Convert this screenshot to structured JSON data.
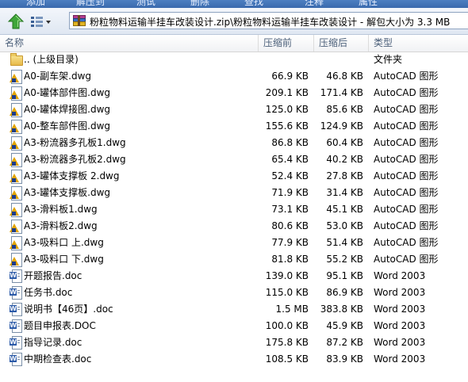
{
  "toolbar": {
    "buttons": [
      "添加",
      "解压到",
      "测试",
      "删除",
      "查找",
      "注释",
      "属性"
    ]
  },
  "address": {
    "path": "粉粒物料运输半挂车改装设计.zip\\粉粒物料运输半挂车改装设计 - 解包大小为 3.3 MB"
  },
  "columns": {
    "name": "名称",
    "size": "压缩前",
    "packed": "压缩后",
    "type": "类型"
  },
  "rows": [
    {
      "icon": "folder-icon",
      "name": ".. (上级目录)",
      "size": "",
      "packed": "",
      "type": "文件夹"
    },
    {
      "icon": "dwg-file-icon",
      "name": "A0-副车架.dwg",
      "size": "66.9 KB",
      "packed": "46.8 KB",
      "type": "AutoCAD 图形"
    },
    {
      "icon": "dwg-file-icon",
      "name": "A0-罐体部件图.dwg",
      "size": "209.1 KB",
      "packed": "171.4 KB",
      "type": "AutoCAD 图形"
    },
    {
      "icon": "dwg-file-icon",
      "name": "A0-罐体焊接图.dwg",
      "size": "125.0 KB",
      "packed": "85.6 KB",
      "type": "AutoCAD 图形"
    },
    {
      "icon": "dwg-file-icon",
      "name": "A0-整车部件图.dwg",
      "size": "155.6 KB",
      "packed": "124.9 KB",
      "type": "AutoCAD 图形"
    },
    {
      "icon": "dwg-file-icon",
      "name": "A3-粉流器多孔板1.dwg",
      "size": "86.8 KB",
      "packed": "60.4 KB",
      "type": "AutoCAD 图形"
    },
    {
      "icon": "dwg-file-icon",
      "name": "A3-粉流器多孔板2.dwg",
      "size": "65.4 KB",
      "packed": "40.2 KB",
      "type": "AutoCAD 图形"
    },
    {
      "icon": "dwg-file-icon",
      "name": "A3-罐体支撑板 2.dwg",
      "size": "52.4 KB",
      "packed": "27.8 KB",
      "type": "AutoCAD 图形"
    },
    {
      "icon": "dwg-file-icon",
      "name": "A3-罐体支撑板.dwg",
      "size": "71.9 KB",
      "packed": "31.4 KB",
      "type": "AutoCAD 图形"
    },
    {
      "icon": "dwg-file-icon",
      "name": "A3-滑料板1.dwg",
      "size": "73.1 KB",
      "packed": "45.1 KB",
      "type": "AutoCAD 图形"
    },
    {
      "icon": "dwg-file-icon",
      "name": "A3-滑料板2.dwg",
      "size": "80.6 KB",
      "packed": "53.0 KB",
      "type": "AutoCAD 图形"
    },
    {
      "icon": "dwg-file-icon",
      "name": "A3-吸料口 上.dwg",
      "size": "77.9 KB",
      "packed": "51.4 KB",
      "type": "AutoCAD 图形"
    },
    {
      "icon": "dwg-file-icon",
      "name": "A3-吸料口 下.dwg",
      "size": "81.8 KB",
      "packed": "55.2 KB",
      "type": "AutoCAD 图形"
    },
    {
      "icon": "doc-file-icon",
      "name": "开题报告.doc",
      "size": "139.0 KB",
      "packed": "95.1 KB",
      "type": "Word 2003"
    },
    {
      "icon": "doc-file-icon",
      "name": "任务书.doc",
      "size": "115.0 KB",
      "packed": "86.9 KB",
      "type": "Word 2003"
    },
    {
      "icon": "doc-file-icon",
      "name": "说明书【46页】.doc",
      "size": "1.5 MB",
      "packed": "383.8 KB",
      "type": "Word 2003"
    },
    {
      "icon": "doc-file-icon",
      "name": "题目申报表.DOC",
      "size": "100.0 KB",
      "packed": "45.9 KB",
      "type": "Word 2003"
    },
    {
      "icon": "doc-file-icon",
      "name": "指导记录.doc",
      "size": "175.8 KB",
      "packed": "87.2 KB",
      "type": "Word 2003"
    },
    {
      "icon": "doc-file-icon",
      "name": "中期检查表.doc",
      "size": "108.5 KB",
      "packed": "83.9 KB",
      "type": "Word 2003"
    }
  ]
}
